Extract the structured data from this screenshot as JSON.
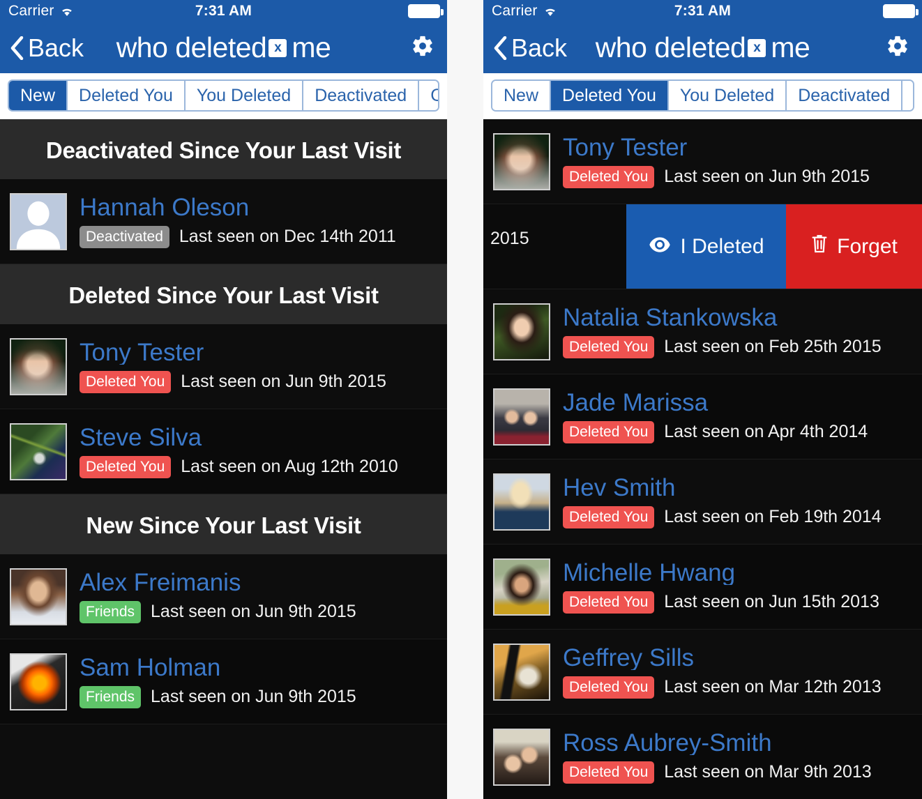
{
  "status_bar": {
    "carrier": "Carrier",
    "wifi_icon": "wifi-icon",
    "time": "7:31 AM",
    "battery_icon": "battery-full-icon"
  },
  "nav_bar": {
    "back_label": "Back",
    "back_icon": "chevron-left-icon",
    "title_part1": "who deleted",
    "title_logo": "x",
    "title_part2": "me",
    "settings_icon": "gear-icon"
  },
  "tabs": [
    {
      "label": "New"
    },
    {
      "label": "Deleted You"
    },
    {
      "label": "You Deleted"
    },
    {
      "label": "Deactivated"
    },
    {
      "label": "Current"
    }
  ],
  "left_panel": {
    "active_tab": "New",
    "sections": [
      {
        "title": "Deactivated Since Your Last Visit",
        "rows": [
          {
            "name": "Hannah Oleson",
            "badge": "Deactivated",
            "badge_type": "deactivated",
            "last_seen": "Last seen on Dec 14th 2011",
            "avatar": "default-silhouette-avatar"
          }
        ]
      },
      {
        "title": "Deleted Since Your Last Visit",
        "rows": [
          {
            "name": "Tony Tester",
            "badge": "Deleted You",
            "badge_type": "deleted",
            "last_seen": "Last seen on Jun 9th 2015",
            "avatar": "photo-man-glasses"
          },
          {
            "name": "Steve Silva",
            "badge": "Deleted You",
            "badge_type": "deleted",
            "last_seen": "Last seen on Aug 12th 2010",
            "avatar": "photo-climber"
          }
        ]
      },
      {
        "title": "New Since Your Last Visit",
        "rows": [
          {
            "name": "Alex Freimanis",
            "badge": "Friends",
            "badge_type": "friends",
            "last_seen": "Last seen on Jun 9th 2015",
            "avatar": "photo-bearded-man"
          },
          {
            "name": "Sam Holman",
            "badge": "Friends",
            "badge_type": "friends",
            "last_seen": "Last seen on Jun 9th 2015",
            "avatar": "photo-helmet-visor"
          }
        ]
      }
    ]
  },
  "right_panel": {
    "active_tab": "Deleted You",
    "rows": [
      {
        "name": "Tony Tester",
        "badge": "Deleted You",
        "badge_type": "deleted",
        "last_seen": "Last seen on Jun 9th 2015",
        "avatar": "photo-man-glasses"
      },
      {
        "name": "Natalia Stankowska",
        "badge": "Deleted You",
        "badge_type": "deleted",
        "last_seen": "Last seen on Feb 25th 2015",
        "avatar": "photo-dark-hair-woman"
      },
      {
        "name": "Jade Marissa",
        "badge": "Deleted You",
        "badge_type": "deleted",
        "last_seen": "Last seen on Apr 4th 2014",
        "avatar": "photo-couple-car"
      },
      {
        "name": "Hev Smith",
        "badge": "Deleted You",
        "badge_type": "deleted",
        "last_seen": "Last seen on Feb 19th 2014",
        "avatar": "photo-blonde-woman"
      },
      {
        "name": "Michelle Hwang",
        "badge": "Deleted You",
        "badge_type": "deleted",
        "last_seen": "Last seen on Jun 15th 2013",
        "avatar": "photo-woman-outdoors"
      },
      {
        "name": "Geffrey Sills",
        "badge": "Deleted You",
        "badge_type": "deleted",
        "last_seen": "Last seen on Mar 12th 2013",
        "avatar": "photo-man-sunglasses"
      },
      {
        "name": "Ross Aubrey-Smith",
        "badge": "Deleted You",
        "badge_type": "deleted",
        "last_seen": "Last seen on Mar 9th 2013",
        "avatar": "photo-couple-hats"
      }
    ],
    "swipe_row": {
      "visible_text": "2015",
      "actions": [
        {
          "label": "I Deleted",
          "icon": "eye-icon",
          "color": "#1a5cb0"
        },
        {
          "label": "Forget",
          "icon": "trash-icon",
          "color": "#d92020"
        }
      ]
    }
  },
  "colors": {
    "nav_blue": "#1c5aa8",
    "link_blue": "#3c79c9",
    "badge_red": "#ef5350",
    "badge_green": "#5fc469",
    "badge_gray": "#8c8c8c",
    "action_blue": "#1a5cb0",
    "action_red": "#d92020",
    "list_bg": "#0d0d0d",
    "section_bg": "#2b2b2b"
  }
}
